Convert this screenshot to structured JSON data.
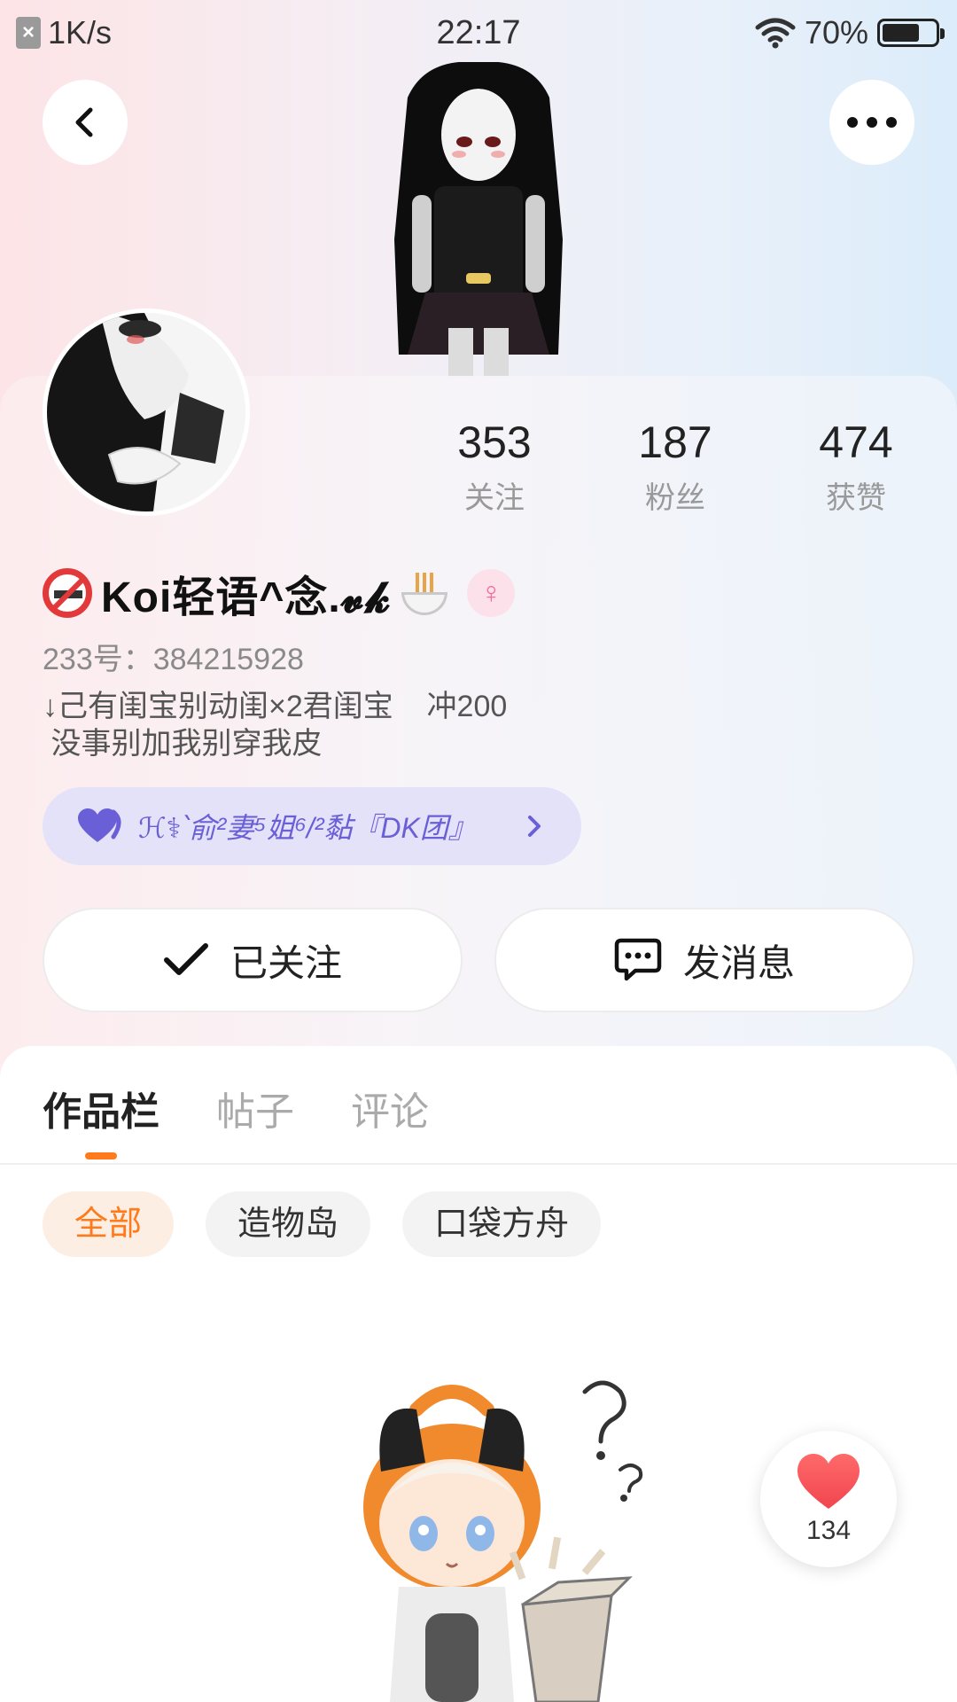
{
  "status_bar": {
    "speed": "1K/s",
    "time": "22:17",
    "battery": "70%",
    "battery_level": 0.7
  },
  "profile": {
    "stats": [
      {
        "value": "353",
        "label": "关注"
      },
      {
        "value": "187",
        "label": "粉丝"
      },
      {
        "value": "474",
        "label": "获赞"
      }
    ],
    "username": "Koi轻语^念.𝓿𝓴",
    "gender_symbol": "♀",
    "uid": "233号：384215928",
    "bio_lines": [
      "↓己有闺宝别动闺×2君闺宝    冲200",
      " 没事别加我别穿我皮"
    ],
    "guild_name": "ℋ⚕՝俞²妻⁵姐⁶/²黏『DK团』"
  },
  "actions": {
    "follow_label": "已关注",
    "message_label": "发消息"
  },
  "tabs": [
    {
      "label": "作品栏",
      "active": true
    },
    {
      "label": "帖子",
      "active": false
    },
    {
      "label": "评论",
      "active": false
    }
  ],
  "chips": [
    {
      "label": "全部",
      "active": true
    },
    {
      "label": "造物岛",
      "active": false
    },
    {
      "label": "口袋方舟",
      "active": false
    }
  ],
  "like_fab": {
    "count": "134"
  },
  "colors": {
    "accent": "#ff7a1a",
    "guild_text": "#6a5fd6",
    "guild_bg": "#e3e2f8",
    "heart": "#f0454f"
  }
}
